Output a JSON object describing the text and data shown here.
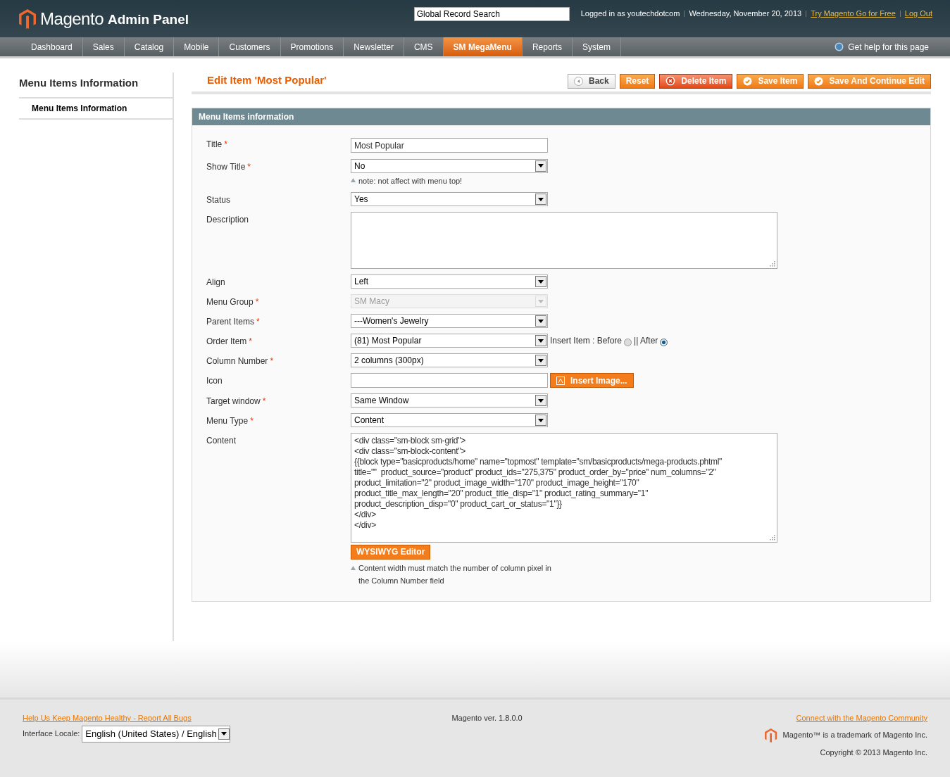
{
  "header": {
    "logo_text": "Magento",
    "logo_suffix": "Admin Panel",
    "search": {
      "placeholder": "Global Record Search"
    },
    "logged_in": "Logged in as youtechdotcom",
    "date": "Wednesday, November 20, 2013",
    "links": [
      "Try Magento Go for Free",
      "Log Out"
    ]
  },
  "nav": {
    "items": [
      {
        "label": "Dashboard",
        "selected": false
      },
      {
        "label": "Sales",
        "selected": false
      },
      {
        "label": "Catalog",
        "selected": false
      },
      {
        "label": "Mobile",
        "selected": false
      },
      {
        "label": "Customers",
        "selected": false
      },
      {
        "label": "Promotions",
        "selected": false
      },
      {
        "label": "Newsletter",
        "selected": false
      },
      {
        "label": "CMS",
        "selected": false
      },
      {
        "label": "SM MegaMenu",
        "selected": true
      },
      {
        "label": "Reports",
        "selected": false
      },
      {
        "label": "System",
        "selected": false
      }
    ],
    "help": "Get help for this page"
  },
  "sidebar": {
    "title": "Menu Items Information",
    "tabs": [
      {
        "label": "Menu Items Information",
        "selected": true
      }
    ]
  },
  "page_title": "Edit Item 'Most Popular'",
  "buttons": [
    {
      "label": "Back",
      "kind": "back"
    },
    {
      "label": "Reset",
      "kind": "plain"
    },
    {
      "label": "Delete Item",
      "kind": "delete"
    },
    {
      "label": "Save Item",
      "kind": "save"
    },
    {
      "label": "Save And Continue Edit",
      "kind": "save"
    }
  ],
  "section": {
    "title": "Menu Items information",
    "fields": [
      {
        "label": "Title",
        "required_mark": "*",
        "kind": "text",
        "value": "Most Popular"
      },
      {
        "label": "Show Title",
        "required_mark": "*",
        "kind": "select",
        "value": "No",
        "note": "note: not affect with menu top!"
      },
      {
        "label": "Status",
        "kind": "select",
        "value": "Yes"
      },
      {
        "label": "Description",
        "kind": "textarea"
      },
      {
        "label": "Align",
        "kind": "select",
        "value": "Left"
      },
      {
        "label": "Menu Group",
        "required_mark": "*",
        "kind": "select",
        "value": "SM Macy",
        "disabled": true
      },
      {
        "label": "Parent Items",
        "required_mark": "*",
        "kind": "select",
        "value": "---Women's Jewelry"
      },
      {
        "label": "Order Item",
        "required_mark": "*",
        "kind": "order",
        "value": "(81) Most Popular",
        "insert_label": "Insert Item : Before",
        "options": [
          {
            "label": "|| After",
            "selected": true
          }
        ],
        "before_selected": false
      },
      {
        "label": "Column Number",
        "required_mark": "*",
        "kind": "select",
        "value": "2 columns (300px)"
      },
      {
        "label": "Icon",
        "kind": "image",
        "button": "Insert Image..."
      },
      {
        "label": "Target window",
        "required_mark": "*",
        "kind": "select",
        "value": "Same Window"
      },
      {
        "label": "Menu Type",
        "required_mark": "*",
        "kind": "select",
        "value": "Content"
      },
      {
        "label": "Content",
        "kind": "code",
        "lines": [
          "<div class=\"sm-block sm-grid\">",
          "<div class=\"sm-block-content\">",
          "{{block type=\"basicproducts/home\" name=\"topmost\" template=\"sm/basicproducts/mega-products.phtml\"",
          "title=\"\"  product_source=\"product\" product_ids=\"275,375\" product_order_by=\"price\" num_columns=\"2\"",
          "product_limitation=\"2\" product_image_width=\"170\" product_image_height=\"170\"",
          "product_title_max_length=\"20\" product_title_disp=\"1\" product_rating_summary=\"1\"",
          "product_description_disp=\"0\" product_cart_or_status=\"1\"}}",
          "</div>",
          "</div>"
        ],
        "button": "WYSIWYG Editor",
        "note_lines": [
          "Content width must match the number of column pixel in",
          "the Column Number field"
        ]
      }
    ]
  },
  "footer": {
    "bug_link": "Help Us Keep Magento Healthy - Report All Bugs",
    "locale_label": "Interface Locale:",
    "locale_value": "English (United States) / English",
    "version": "Magento ver. 1.8.0.0",
    "community_link": "Connect with the Magento Community",
    "trademark": "Magento™ is a trademark of Magento Inc.",
    "copyright": "Copyright © 2013 Magento Inc."
  }
}
